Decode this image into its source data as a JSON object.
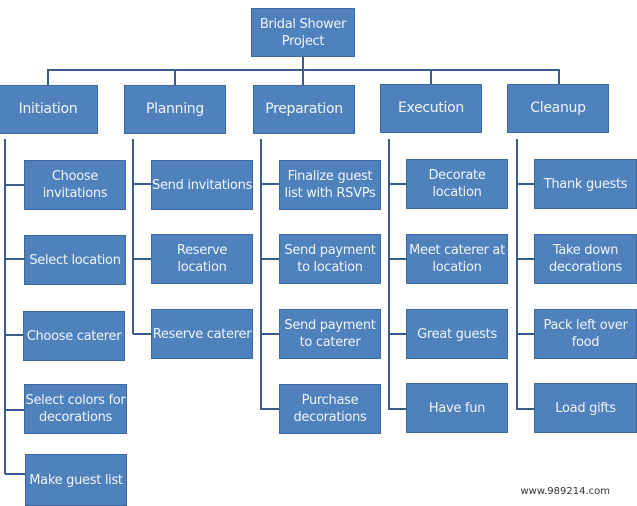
{
  "diagram": {
    "type": "work-breakdown-structure",
    "colors": {
      "box_fill": "#4f81bd",
      "box_text": "#eef3fa",
      "connector": "#385d8a"
    },
    "root": {
      "label": "Bridal Shower\nProject"
    },
    "phases": [
      {
        "label": "Initiation",
        "tasks": [
          "Choose\ninvitations",
          "Select location",
          "Choose caterer",
          "Select colors for\ndecorations",
          "Make guest list"
        ]
      },
      {
        "label": "Planning",
        "tasks": [
          "Send invitations",
          "Reserve\nlocation",
          "Reserve caterer"
        ]
      },
      {
        "label": "Preparation",
        "tasks": [
          "Finalize guest\nlist with RSVPs",
          "Send payment\nto location",
          "Send payment\nto caterer",
          "Purchase\ndecorations"
        ]
      },
      {
        "label": "Execution",
        "tasks": [
          "Decorate\nlocation",
          "Meet caterer at\nlocation",
          "Great guests",
          "Have fun"
        ]
      },
      {
        "label": "Cleanup",
        "tasks": [
          "Thank guests",
          "Take down\ndecorations",
          "Pack left over\nfood",
          "Load gifts"
        ]
      }
    ]
  },
  "watermark": "www.989214.com"
}
